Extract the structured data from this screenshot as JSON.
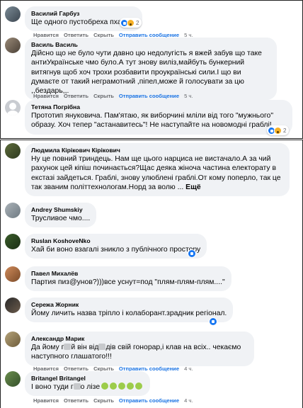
{
  "actions": {
    "like": "Нравится",
    "reply": "Ответить",
    "hide": "Скрыть",
    "msg": "Отправить сообщение"
  },
  "top": [
    {
      "name": "Василий Гарбуз",
      "text": "Ще одного пустобреха пхають!",
      "time": "5 ч.",
      "reactions": "2"
    },
    {
      "name": "Василь Василь",
      "text": "Дійсно що не було чути давно цю недолугість я вжей забув що таке антиУкраїнське чмо було.А тут знову вилiз,майбуть бункерний витягнув щоб хоч трохи розбавити проукраїнські сили.І що ви думаєте от такий нeграмотний ,пiпел,може й голосувати за цю ,,бездарь,,.",
      "time": "5 ч."
    },
    {
      "name": "Тетяна Погрібна",
      "text": "Прототип януковича. Пам'ятаю, як виборчині мліли від того \"мужнього\" образу. Хоч тепер \"астанавитесь\"! Не наступайте на новомодні граблі!",
      "reactions": "2"
    }
  ],
  "bottom": [
    {
      "name": "Людмила Кірікович Кірікович",
      "text": "Ну це повний триндець. Нам ще цього нарциса не вистачало.А за чий рахунок цей кіпіш починається?Щас деяка жіноча частина електорату в екстазі зайдеться. Граблі, знову улюблені граблі.От кому поперло, так це так званим політтехнологам.Норд за волю ...",
      "more": "Ещё"
    },
    {
      "name": "Andrey Shumskiy",
      "text": "Трусливое чмо...."
    },
    {
      "name": "Ruslan KoshoveNko",
      "text": "Хай би воно взагалі зникло з публічного простору"
    },
    {
      "name": "Павел Михалёв",
      "text": "Партия пиз@унов?)))все уснут=под \"плям-плям-плям....\""
    },
    {
      "name": "Сережа Жорник",
      "text": "Йому личить назва тріпло і колаборант.зрадник регіонал."
    },
    {
      "name": "Александр Марик",
      "text_a": "Да йому г",
      "text_b": "й він від",
      "text_c": "дів свій гонорар,і клав на всіх.. чекаємо наступного глашатого!!!",
      "time": "4 ч."
    },
    {
      "name": "Britangel Britangel",
      "text_a": "І воно туди г",
      "text_b": "о лізе",
      "time": "4 ч."
    }
  ]
}
